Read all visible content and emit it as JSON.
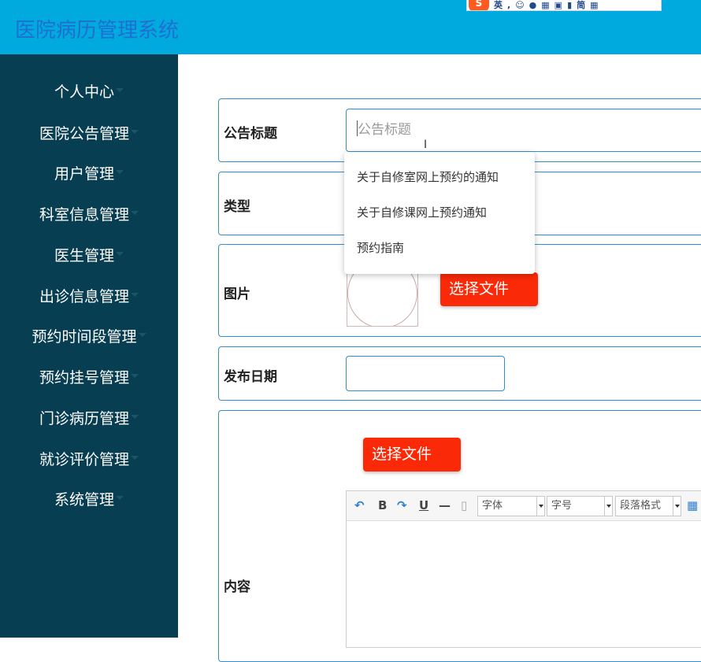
{
  "app": {
    "title": "医院病历管理系统"
  },
  "ime": {
    "mode": "英"
  },
  "sidebar": {
    "items": [
      {
        "label": "个人中心"
      },
      {
        "label": "医院公告管理"
      },
      {
        "label": "用户管理"
      },
      {
        "label": "科室信息管理"
      },
      {
        "label": "医生管理"
      },
      {
        "label": "出诊信息管理"
      },
      {
        "label": "预约时间段管理"
      },
      {
        "label": "预约挂号管理"
      },
      {
        "label": "门诊病历管理"
      },
      {
        "label": "就诊评价管理"
      },
      {
        "label": "系统管理"
      }
    ]
  },
  "form": {
    "title_label": "公告标题",
    "title_placeholder": "公告标题",
    "type_label": "类型",
    "image_label": "图片",
    "image_button": "选择文件",
    "date_label": "发布日期",
    "date_value": "",
    "content_label": "内容",
    "content_button": "选择文件"
  },
  "autocomplete": {
    "items": [
      {
        "label": "关于自修室网上预约的通知"
      },
      {
        "label": "关于自修课网上预约通知"
      },
      {
        "label": "预约指南"
      }
    ]
  },
  "editor": {
    "bold": "B",
    "underline": "U",
    "font_select": "字体",
    "size_select": "字号",
    "paragraph_select": "段落格式"
  },
  "colors": {
    "topbar": "#00aade",
    "sidebar": "#073e52",
    "accent_border": "#2f8fd0",
    "button": "#fa2a08"
  }
}
